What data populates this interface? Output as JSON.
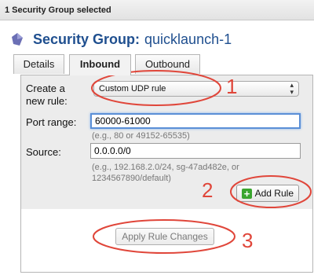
{
  "header": {
    "selected_text": "1 Security Group selected"
  },
  "title": {
    "label": "Security Group:",
    "value": "quicklaunch-1"
  },
  "tabs": [
    {
      "label": "Details"
    },
    {
      "label": "Inbound"
    },
    {
      "label": "Outbound"
    }
  ],
  "form": {
    "create_rule_label_line1": "Create a",
    "create_rule_label_line2": "new rule:",
    "rule_select_value": "Custom UDP rule",
    "port_range_label": "Port range:",
    "port_range_value": "60000-61000",
    "port_range_hint": "(e.g., 80 or 49152-65535)",
    "source_label": "Source:",
    "source_value": "0.0.0.0/0",
    "source_hint_line1": "(e.g., 192.168.2.0/24, sg-47ad482e, or",
    "source_hint_line2": "1234567890/default)",
    "add_rule_label": "Add Rule",
    "apply_label": "Apply Rule Changes"
  },
  "annotations": {
    "step1": "1",
    "step2": "2",
    "step3": "3"
  },
  "colors": {
    "annotation": "#e0463a",
    "title": "#1f4f8f",
    "add_icon": "#3aa52e"
  }
}
